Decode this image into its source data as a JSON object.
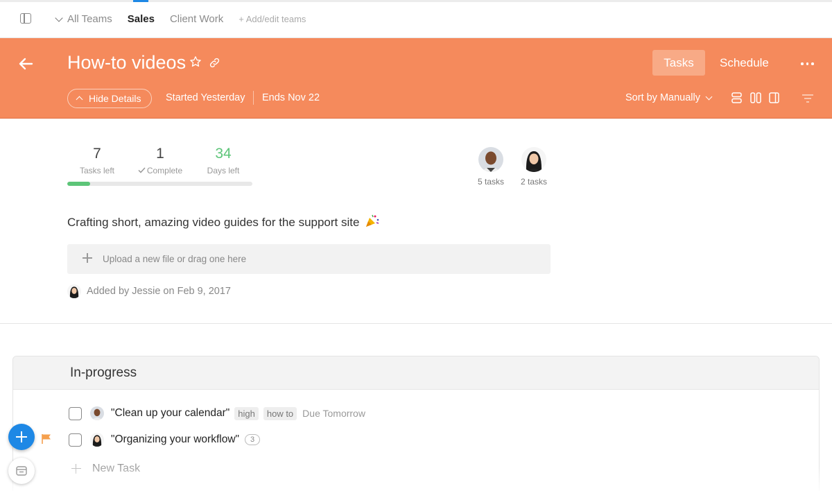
{
  "topbar": {
    "teams": [
      "All Teams",
      "Sales",
      "Client Work"
    ],
    "active_team": "Sales",
    "add_label": "+ Add/edit teams"
  },
  "header": {
    "title": "How-to videos",
    "hide_details_label": "Hide Details",
    "started": "Started Yesterday",
    "ends": "Ends Nov 22",
    "tabs": [
      "Tasks",
      "Schedule"
    ],
    "sort_label": "Sort by Manually",
    "accent_color": "#f58a5c"
  },
  "stats": {
    "tasks_left": {
      "value": "7",
      "label": "Tasks left"
    },
    "complete": {
      "value": "1",
      "label": "Complete"
    },
    "days_left": {
      "value": "34",
      "label": "Days left"
    },
    "progress_fraction": 0.125
  },
  "members": [
    {
      "tasks": "5 tasks"
    },
    {
      "tasks": "2 tasks"
    }
  ],
  "description": "Crafting short, amazing video guides for the support site",
  "upload_placeholder": "Upload a new file or drag one here",
  "added_by": "Added by Jessie on Feb 9, 2017",
  "list": {
    "title": "In-progress",
    "tasks": [
      {
        "title": "\"Clean up your calendar\"",
        "tags": [
          "high",
          "how to"
        ],
        "due": "Due Tomorrow"
      },
      {
        "title": "\"Organizing your workflow\"",
        "comments": "3"
      }
    ],
    "new_task_label": "New Task"
  }
}
